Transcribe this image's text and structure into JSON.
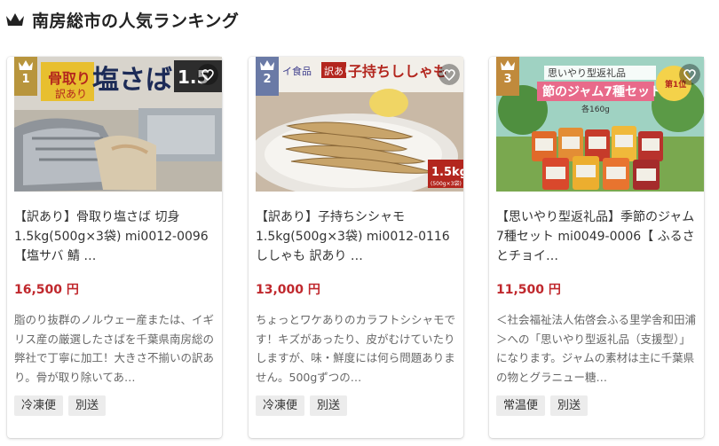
{
  "page": {
    "title": "南房総市の人気ランキング"
  },
  "colors": {
    "price": "#c0282d",
    "rank_badge": "#b8953d",
    "rank_badge_3": "#c08a3c"
  },
  "items": [
    {
      "rank": "1",
      "image_text": "骨取り 訳あり 塩さば 1.5",
      "name": "【訳あり】骨取り塩さば 切身1.5kg(500g×3袋) mi0012-0096【塩サバ 鯖 …",
      "price": "16,500 円",
      "description": "脂のり抜群のノルウェー産または、イギリス産の厳選したさばを千葉県南房総の弊社で丁寧に加工！大きさ不揃いの訳あり。骨が取り除いてあ…",
      "tags": [
        "冷凍便",
        "別送"
      ]
    },
    {
      "rank": "2",
      "image_text": "イ食品 訳あり 子持ちししゃも 1.5kg (500g×3袋)",
      "name": "【訳あり】子持ちシシャモ 1.5kg(500g×3袋) mi0012-0116 ししゃも 訳あり …",
      "price": "13,000 円",
      "description": "ちょっとワケありのカラフトシシャモです！キズがあったり、皮がむけていたりしますが、味・鮮度には何ら問題ありません。500gずつの…",
      "tags": [
        "冷凍便",
        "別送"
      ]
    },
    {
      "rank": "3",
      "image_text": "思いやり型返礼品 節のジャム7種セット 各160g 第1位",
      "name": "【思いやり型返礼品】季節のジャム7種セット mi0049-0006【 ふるさとチョイ…",
      "price": "11,500 円",
      "description": "＜社会福祉法人佑啓会ふる里学舎和田浦＞への「思いやり型返礼品（支援型）」になります。ジャムの素材は主に千葉県の物とグラニュー糖…",
      "tags": [
        "常温便",
        "別送"
      ]
    }
  ]
}
